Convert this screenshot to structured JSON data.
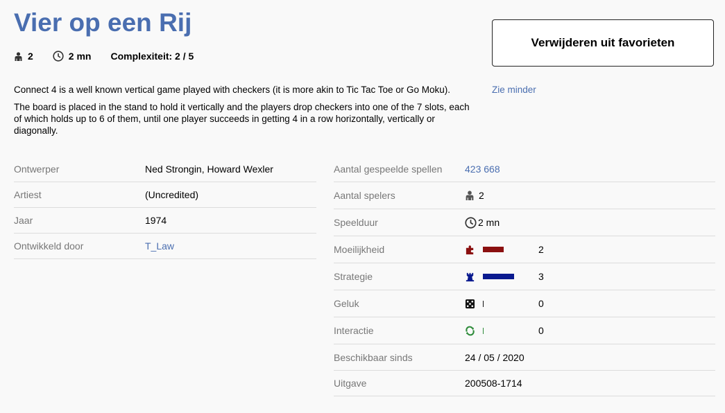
{
  "game": {
    "title": "Vier op een Rij",
    "players": "2",
    "duration": "2 mn",
    "complexity": "Complexiteit: 2 / 5"
  },
  "favorite_button": "Verwijderen uit favorieten",
  "description": {
    "short": "Connect 4 is a well known vertical game played with checkers (it is more akin to Tic Tac Toe or Go Moku).",
    "long": "The board is placed in the stand to hold it vertically and the players drop checkers into one of the 7 slots, each of which holds up to 6 of them, until one player succeeds in getting 4 in a row horizontally, vertically or diagonally.",
    "see_less": "Zie minder"
  },
  "details_left": [
    {
      "label": "Ontwerper",
      "value": "Ned Strongin, Howard Wexler"
    },
    {
      "label": "Artiest",
      "value": "(Uncredited)"
    },
    {
      "label": "Jaar",
      "value": "1974"
    },
    {
      "label": "Ontwikkeld door",
      "value": "T_Law"
    }
  ],
  "details_right": {
    "games_played": {
      "label": "Aantal gespeelde spellen",
      "value": "423 668"
    },
    "num_players": {
      "label": "Aantal spelers",
      "value": "2"
    },
    "play_time": {
      "label": "Speelduur",
      "value": "2 mn"
    },
    "difficulty": {
      "label": "Moeilijkheid",
      "value": "2",
      "level": 2,
      "max": 5,
      "color": "#8b1010"
    },
    "strategy": {
      "label": "Strategie",
      "value": "3",
      "level": 3,
      "max": 5,
      "color": "#0a1a8f"
    },
    "luck": {
      "label": "Geluk",
      "value": "0",
      "level": 0,
      "max": 5,
      "color": "#111111"
    },
    "interaction": {
      "label": "Interactie",
      "value": "0",
      "level": 0,
      "max": 5,
      "color": "#2e8b3a"
    },
    "available_since": {
      "label": "Beschikbaar sinds",
      "value": "24 / 05 / 2020"
    },
    "version": {
      "label": "Uitgave",
      "value": "200508-1714"
    }
  },
  "colors": {
    "link": "#4a6eb0",
    "title": "#4a6eb0",
    "label": "#777777"
  },
  "icons": {
    "players": "person-icon",
    "duration": "clock-icon",
    "difficulty": "puzzle-icon",
    "strategy": "chess-rook-icon",
    "luck": "dice-icon",
    "interaction": "recycle-arrows-icon"
  }
}
